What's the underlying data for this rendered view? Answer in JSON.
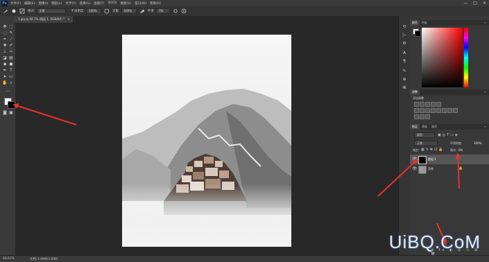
{
  "menubar": {
    "logo": "Ps",
    "items": [
      "文件(F)",
      "编辑(E)",
      "图像(I)",
      "图层(L)",
      "文字(Y)",
      "选择(S)",
      "滤镜(T)",
      "3D(D)",
      "视图(V)",
      "窗口(W)",
      "帮助(H)"
    ]
  },
  "window_controls": {
    "minimize": "—",
    "maximize": "□",
    "close": "✕"
  },
  "options_bar": {
    "mode_label": "模式:",
    "mode_value": "正常",
    "opacity_label": "不透明度:",
    "opacity_value": "100%",
    "flow_label": "流量:",
    "flow_value": "100%",
    "smoothing_label": "平滑:",
    "smoothing_value": "0%"
  },
  "document_tab": {
    "title": "1.jpg @ 66.7% (图层 1, RGB/8#) *",
    "close": "×"
  },
  "color_panel": {
    "tabs": [
      "颜色",
      "色板"
    ]
  },
  "adjustments_panel": {
    "tabs": [
      "调整"
    ],
    "title": "添加调整"
  },
  "layers_panel": {
    "tabs": [
      "图层",
      "通道",
      "路径"
    ],
    "kind_filter": "类型",
    "blend_mode": "正常",
    "opacity_label": "不透明度:",
    "opacity_value": "100%",
    "lock_label": "锁定:",
    "fill_label": "填充:",
    "fill_value": "0%",
    "layers": [
      {
        "name": "图层 1",
        "selected": true
      },
      {
        "name": "背景",
        "selected": false
      }
    ]
  },
  "status_bar": {
    "zoom": "66.67%",
    "doc_info": "文档:3.99M/3.99M"
  },
  "watermark": "UiBQ.CoM",
  "colors": {
    "accent": "#31a8ff",
    "arrow": "#e8322a",
    "panel": "#383838",
    "canvas_bg": "#282828"
  }
}
